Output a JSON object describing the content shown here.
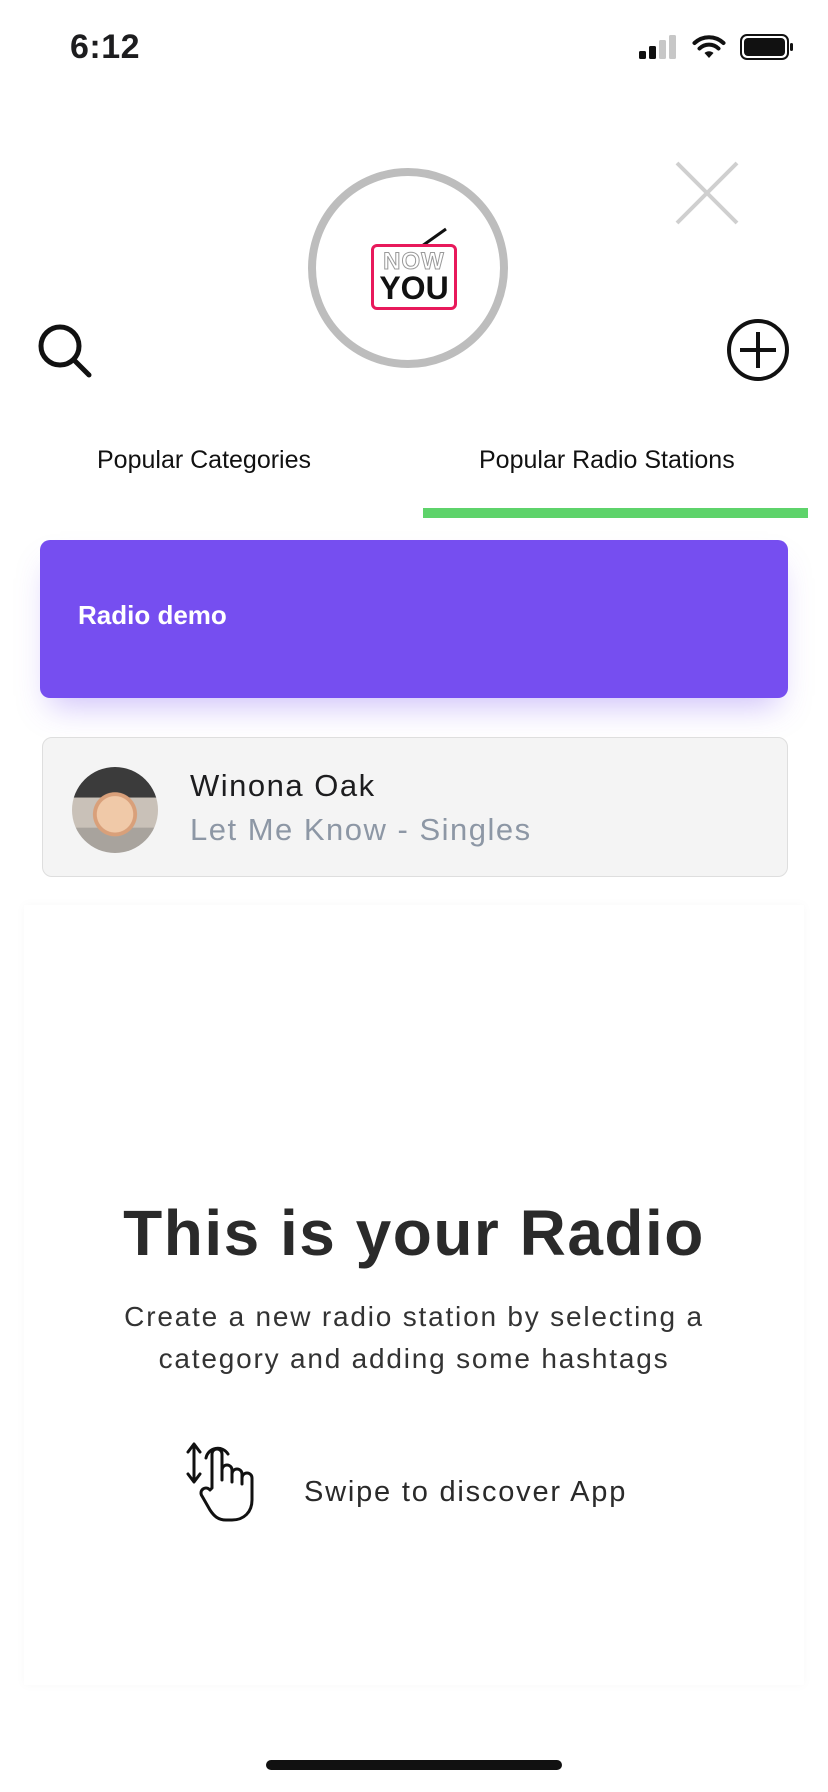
{
  "status_bar": {
    "time": "6:12"
  },
  "logo": {
    "line1": "NOW",
    "line2": "YOU",
    "accent": "#e8195b"
  },
  "header_icons": {
    "close": "close-icon",
    "search": "search-icon",
    "add": "plus-circle-icon"
  },
  "tabs": [
    {
      "label": "Popular Categories",
      "active": false
    },
    {
      "label": "Popular Radio Stations",
      "active": true
    }
  ],
  "tab_indicator_color": "#5ed36b",
  "demo_card": {
    "title": "Radio demo",
    "color": "#764ef0"
  },
  "track": {
    "artist": "Winona Oak",
    "subtitle": "Let Me Know - Singles"
  },
  "onboarding": {
    "headline": "This is your Radio",
    "description": "Create a new radio station by selecting a category and adding some hashtags",
    "swipe_label": "Swipe to discover App",
    "swipe_icon": "swipe-hand-icon"
  }
}
